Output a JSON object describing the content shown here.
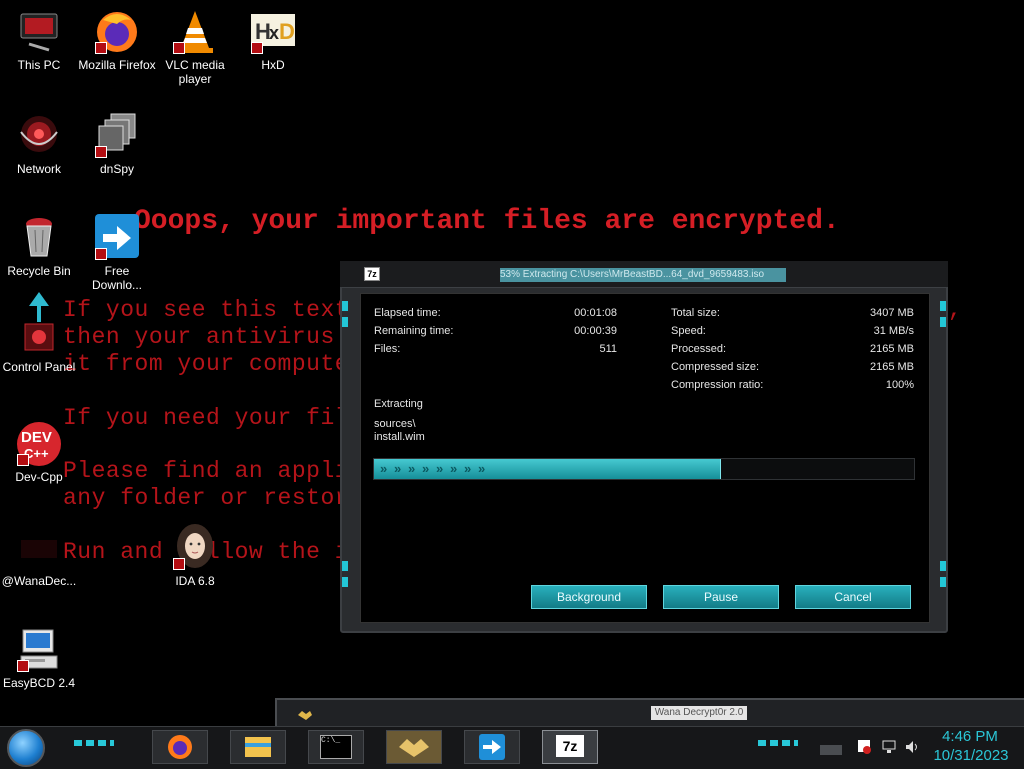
{
  "wallpaper": {
    "headline": "Ooops, your important files are encrypted.",
    "lines": [
      "If you see this text",
      "then your antivirus",
      "it from your compute",
      "If you need your fil",
      "Please find an appli",
      "any folder or restor",
      "Run and follow the i"
    ],
    "line_tail": ","
  },
  "desktop_icons": [
    {
      "label": "This PC",
      "icon": "this-pc-icon"
    },
    {
      "label": "Mozilla Firefox",
      "icon": "firefox-icon"
    },
    {
      "label": "VLC media player",
      "icon": "vlc-icon"
    },
    {
      "label": "HxD",
      "icon": "hxd-icon"
    },
    {
      "label": "Network",
      "icon": "network-icon"
    },
    {
      "label": "dnSpy",
      "icon": "dnspy-icon"
    },
    {
      "label": "Recycle Bin",
      "icon": "recycle-bin-icon"
    },
    {
      "label": "Free Downlo...",
      "icon": "free-download-icon"
    },
    {
      "label": "Control Panel",
      "icon": "control-panel-icon"
    },
    {
      "label": "Dev-Cpp",
      "icon": "dev-cpp-icon"
    },
    {
      "label": "@WanaDec...",
      "icon": "wanadecryptor-icon"
    },
    {
      "label": "IDA 6.8",
      "icon": "ida-icon"
    },
    {
      "label": "EasyBCD 2.4",
      "icon": "easybcd-icon"
    }
  ],
  "dialog": {
    "app_icon_text": "7z",
    "title": "53% Extracting C:\\Users\\MrBeastBD...64_dvd_9659483.iso",
    "left": [
      {
        "label": "Elapsed time:",
        "value": "00:01:08"
      },
      {
        "label": "Remaining time:",
        "value": "00:00:39"
      },
      {
        "label": "Files:",
        "value": "511"
      }
    ],
    "right": [
      {
        "label": "Total size:",
        "value": "3407 MB"
      },
      {
        "label": "Speed:",
        "value": "31 MB/s"
      },
      {
        "label": "Processed:",
        "value": "2165 MB"
      },
      {
        "label": "Compressed size:",
        "value": "2165 MB"
      },
      {
        "label": "Compression ratio:",
        "value": "100%"
      }
    ],
    "status_label": "Extracting",
    "current_path": "sources\\",
    "current_file": "install.wim",
    "progress": 0.64,
    "buttons": {
      "background": "Background",
      "pause": "Pause",
      "cancel": "Cancel"
    }
  },
  "taskbar": {
    "tooltip": "Wana Decrypt0r 2.0",
    "apps": [
      "firefox-icon",
      "file-explorer-icon",
      "command-prompt-icon",
      "wanadecryptor-icon",
      "free-download-icon",
      "7zip-icon"
    ],
    "cmd_text": "C:\\_",
    "sevenzip_text": "7z",
    "clock": {
      "time": "4:46 PM",
      "date": "10/31/2023"
    }
  },
  "colors": {
    "accent": "#28c8d8",
    "warning_red": "#c4161c"
  }
}
